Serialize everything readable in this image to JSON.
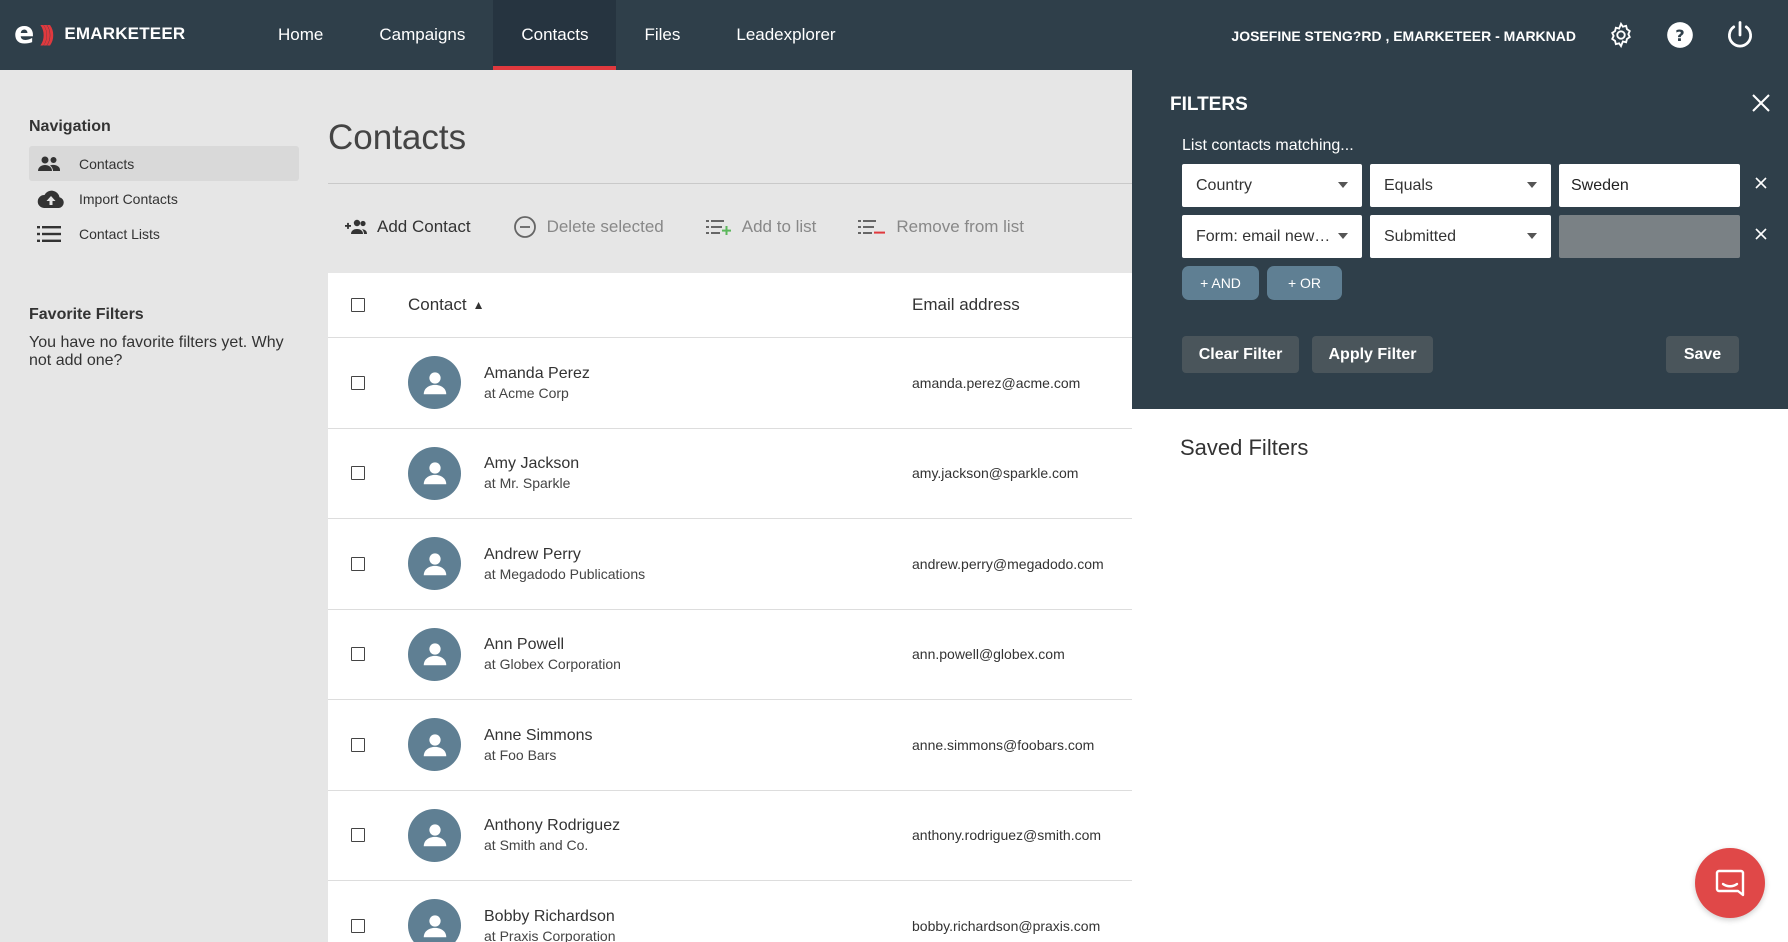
{
  "brand": {
    "name": "EMARKETEER",
    "mark": "e"
  },
  "nav": {
    "items": [
      {
        "label": "Home",
        "active": false
      },
      {
        "label": "Campaigns",
        "active": false
      },
      {
        "label": "Contacts",
        "active": true
      },
      {
        "label": "Files",
        "active": false
      },
      {
        "label": "Leadexplorer",
        "active": false
      }
    ],
    "user": "JOSEFINE STENG?RD , EMARKETEER - MARKNAD",
    "icons": [
      "gear-icon",
      "help-icon",
      "power-icon"
    ]
  },
  "sidebar": {
    "heading": "Navigation",
    "items": [
      {
        "label": "Contacts",
        "icon": "people-icon",
        "active": true
      },
      {
        "label": "Import Contacts",
        "icon": "cloud-upload-icon",
        "active": false
      },
      {
        "label": "Contact Lists",
        "icon": "list-icon",
        "active": false
      }
    ],
    "favorites_heading": "Favorite Filters",
    "favorites_empty": "You have no favorite filters yet. Why not add one?"
  },
  "main": {
    "title": "Contacts",
    "toolbar": {
      "add_contact": "Add Contact",
      "delete_selected": "Delete selected",
      "add_to_list": "Add to list",
      "remove_from_list": "Remove from list"
    },
    "table": {
      "col_contact": "Contact",
      "col_email": "Email address",
      "sort_indicator": "▲",
      "rows": [
        {
          "name": "Amanda Perez",
          "company": "at Acme Corp",
          "email": "amanda.perez@acme.com"
        },
        {
          "name": "Amy Jackson",
          "company": "at Mr. Sparkle",
          "email": "amy.jackson@sparkle.com"
        },
        {
          "name": "Andrew Perry",
          "company": "at Megadodo Publications",
          "email": "andrew.perry@megadodo.com"
        },
        {
          "name": "Ann Powell",
          "company": "at Globex Corporation",
          "email": "ann.powell@globex.com"
        },
        {
          "name": "Anne Simmons",
          "company": "at Foo Bars",
          "email": "anne.simmons@foobars.com"
        },
        {
          "name": "Anthony Rodriguez",
          "company": "at Smith and Co.",
          "email": "anthony.rodriguez@smith.com"
        },
        {
          "name": "Bobby Richardson",
          "company": "at Praxis Corporation",
          "email": "bobby.richardson@praxis.com"
        }
      ]
    }
  },
  "filters": {
    "title": "FILTERS",
    "subtitle": "List contacts matching...",
    "rows": [
      {
        "field": "Country",
        "operator": "Equals",
        "value": "Sweden"
      },
      {
        "field": "Form: email new…",
        "operator": "Submitted",
        "value": ""
      }
    ],
    "and_label": "+ AND",
    "or_label": "+ OR",
    "clear_label": "Clear Filter",
    "apply_label": "Apply Filter",
    "save_label": "Save",
    "saved_title": "Saved Filters"
  },
  "colors": {
    "topbar": "#2f3f4a",
    "accent": "#e0393e",
    "avatar": "#5f7f93",
    "chat": "#e04848"
  }
}
